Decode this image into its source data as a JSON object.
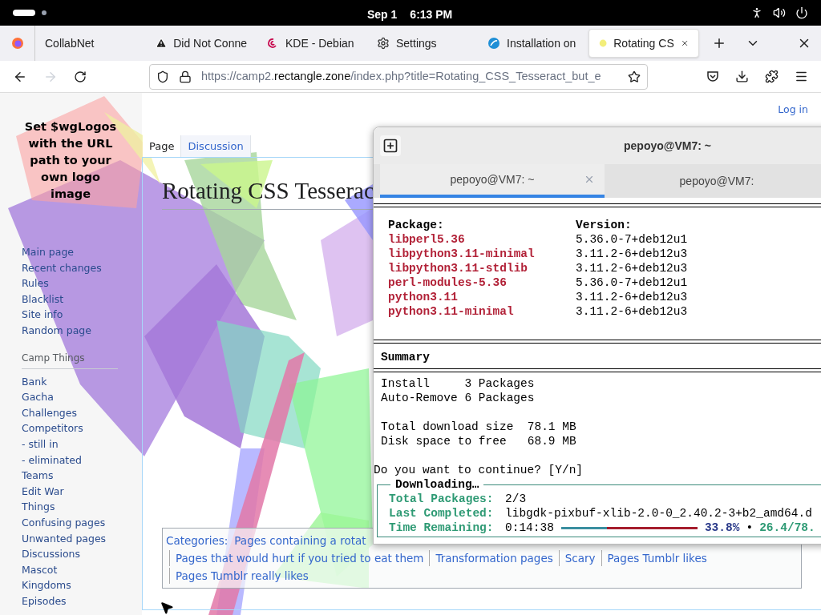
{
  "top_bar": {
    "date": "Sep 1",
    "time": "6:13 PM"
  },
  "browser": {
    "tabs": [
      {
        "label": "CollabNet",
        "selected": false
      },
      {
        "label": "Did Not Conne",
        "selected": false
      },
      {
        "label": "KDE - Debian",
        "selected": false
      },
      {
        "label": "Settings",
        "selected": false
      },
      {
        "label": "Installation on",
        "selected": false
      },
      {
        "label": "Rotating CS",
        "selected": true
      }
    ],
    "address": {
      "prefix": "https://camp2.",
      "domain": "rectangle.zone",
      "rest": "/index.php?title=Rotating_CSS_Tesseract_but_e"
    }
  },
  "wiki": {
    "logo_text": "Set $wgLogos with the URL path to your own logo image",
    "login": "Log in",
    "nav": [
      "Main page",
      "Recent changes",
      "Rules",
      "Blacklist",
      "Site info",
      "Random page"
    ],
    "section": {
      "heading": "Camp Things",
      "items": [
        "Bank",
        "Gacha",
        "Challenges",
        "Competitors",
        "- still in",
        "- eliminated",
        "Teams",
        "Edit War",
        "Things",
        "Confusing pages",
        "Unwanted pages",
        "Discussions",
        "Mascot",
        "Kingdoms",
        "Episodes"
      ]
    },
    "page_tabs": [
      {
        "label": "Page",
        "selected": true
      },
      {
        "label": "Discussion",
        "selected": false
      }
    ],
    "title": "Rotating CSS Tesserac",
    "categories": {
      "label": "Categories:",
      "first": "Pages containing a rotat",
      "links": [
        "Pages that would hurt if you tried to eat them",
        "Transformation pages",
        "Scary",
        "Pages Tumblr likes",
        "Pages Tumblr really likes"
      ]
    }
  },
  "terminal": {
    "title": "pepoyo@VM7: ~",
    "tabs": [
      {
        "label": "pepoyo@VM7: ~",
        "selected": true
      },
      {
        "label": "pepoyo@VM7:",
        "selected": false
      }
    ],
    "package_header": [
      "Package:",
      "Version:"
    ],
    "packages": [
      {
        "name": "libperl5.36",
        "version": "5.36.0-7+deb12u1"
      },
      {
        "name": "libpython3.11-minimal",
        "version": "3.11.2-6+deb12u3"
      },
      {
        "name": "libpython3.11-stdlib",
        "version": "3.11.2-6+deb12u3"
      },
      {
        "name": "perl-modules-5.36",
        "version": "5.36.0-7+deb12u1"
      },
      {
        "name": "python3.11",
        "version": "3.11.2-6+deb12u3"
      },
      {
        "name": "python3.11-minimal",
        "version": "3.11.2-6+deb12u3"
      }
    ],
    "summary_heading": "Summary",
    "summary_lines": [
      [
        "Install     3 Packages",
        "Auto-Remove 6 Packages"
      ],
      [
        "Total download size  78.1 MB",
        "Disk space to free   68.9 MB"
      ]
    ],
    "prompt": "Do you want to continue? [Y/n]",
    "download": {
      "title": "Downloading…",
      "rows": [
        {
          "label": "Total Packages:",
          "value": "2/3"
        },
        {
          "label": "Last Completed:",
          "value": "libgdk-pixbuf-xlib-2.0-0_2.40.2-3+b2_amd64.d"
        }
      ],
      "time_label": "Time Remaining:",
      "time": "0:14:38",
      "level": 0.338,
      "percent": "33.8%",
      "separator": "•",
      "size": "26.4/78."
    }
  }
}
